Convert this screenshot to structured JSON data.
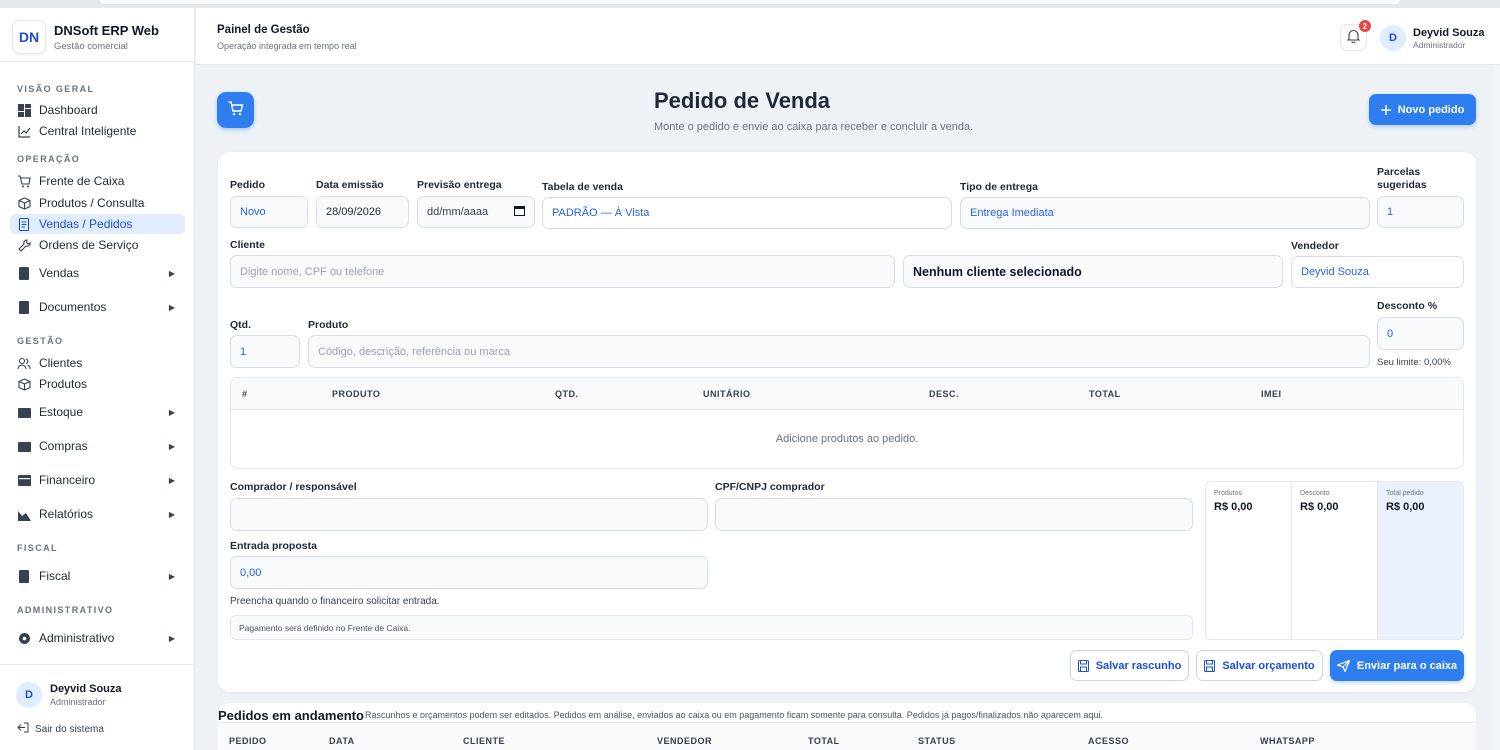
{
  "brand": {
    "name": "DNSoft ERP Web",
    "subtitle": "Gestão comercial",
    "logo": "DN"
  },
  "sidebar": {
    "sections": {
      "visao_geral": "VISÃO GERAL",
      "operacao": "OPERAÇÃO",
      "gestao": "GESTÃO",
      "fiscal": "FISCAL",
      "administrativo": "ADMINISTRATIVO"
    },
    "items": {
      "dashboard": "Dashboard",
      "central": "Central Inteligente",
      "frente_caixa": "Frente de Caixa",
      "produtos_consulta": "Produtos / Consulta",
      "vendas_pedidos": "Vendas / Pedidos",
      "ordens_servico": "Ordens de Serviço",
      "vendas": "Vendas",
      "documentos": "Documentos",
      "clientes": "Clientes",
      "produtos": "Produtos",
      "estoque": "Estoque",
      "compras": "Compras",
      "financeiro": "Financeiro",
      "relatorios": "Relatórios",
      "fiscal": "Fiscal",
      "administrativo": "Administrativo"
    },
    "active_item": "Vendas / Pedidos",
    "user": {
      "initial": "D",
      "name": "Deyvid Souza",
      "role": "Administrador"
    },
    "logout": "Sair do sistema"
  },
  "header": {
    "title": "Painel de Gestão",
    "subtitle": "Operação integrada em tempo real",
    "notifications": "2",
    "user": {
      "initial": "D",
      "name": "Deyvid Souza",
      "role": "Administrador"
    }
  },
  "page": {
    "title": "Pedido de Venda",
    "subtitle": "Monte o pedido e envie ao caixa para receber e concluir a venda.",
    "new_order": "Novo pedido"
  },
  "form": {
    "pedido": {
      "label": "Pedido",
      "value": "Novo"
    },
    "data_emissao": {
      "label": "Data emissão",
      "value": "28/09/2026"
    },
    "previsao": {
      "label": "Previsão entrega",
      "placeholder": "dd/mm/aaaa"
    },
    "tabela": {
      "label": "Tabela de venda",
      "value": "PADRÃO — À Vista"
    },
    "tipo_entrega": {
      "label": "Tipo de entrega",
      "value": "Entrega Imediata"
    },
    "parcelas": {
      "label": "Parcelas sugeridas",
      "value": "1"
    },
    "cliente": {
      "label": "Cliente",
      "placeholder": "Digite nome, CPF ou telefone",
      "selected": "Nenhum cliente selecionado"
    },
    "vendedor": {
      "label": "Vendedor",
      "value": "Deyvid Souza"
    },
    "qtd": {
      "label": "Qtd.",
      "value": "1"
    },
    "produto": {
      "label": "Produto",
      "placeholder": "Código, descrição, referência ou marca"
    },
    "desconto": {
      "label": "Desconto %",
      "value": "0",
      "hint": "Seu limite: 0,00%"
    },
    "comprador": {
      "label": "Comprador / responsável",
      "value": ""
    },
    "cpf": {
      "label": "CPF/CNPJ comprador",
      "value": ""
    },
    "entrada": {
      "label": "Entrada proposta",
      "value": "0,00",
      "hint": "Preencha quando o financeiro solicitar entrada."
    },
    "payment_note": "Pagamento será definido no Frente de Caixa."
  },
  "items_table": {
    "columns": [
      "#",
      "PRODUTO",
      "QTD.",
      "UNITÁRIO",
      "DESC.",
      "TOTAL",
      "IMEI"
    ],
    "empty": "Adicione produtos ao pedido."
  },
  "totals": {
    "produtos": {
      "label": "Produtos",
      "value": "R$ 0,00"
    },
    "desconto": {
      "label": "Desconto",
      "value": "R$ 0,00"
    },
    "total": {
      "label": "Total pedido",
      "value": "R$ 0,00"
    }
  },
  "actions": {
    "rascunho": "Salvar rascunho",
    "orcamento": "Salvar orçamento",
    "enviar": "Enviar para o caixa"
  },
  "orders_list": {
    "title": "Pedidos em andamento",
    "subtitle": "Rascunhos e orçamentos podem ser editados. Pedidos em análise, enviados ao caixa ou em pagamento ficam somente para consulta. Pedidos já pagos/finalizados não aparecem aqui.",
    "columns": [
      "PEDIDO",
      "DATA",
      "CLIENTE",
      "VENDEDOR",
      "TOTAL",
      "STATUS",
      "ACESSO",
      "WHATSAPP"
    ]
  },
  "colors": {
    "accent": "#2f7ef0",
    "active_bg": "#e0ecff",
    "badge": "#ef4444"
  }
}
